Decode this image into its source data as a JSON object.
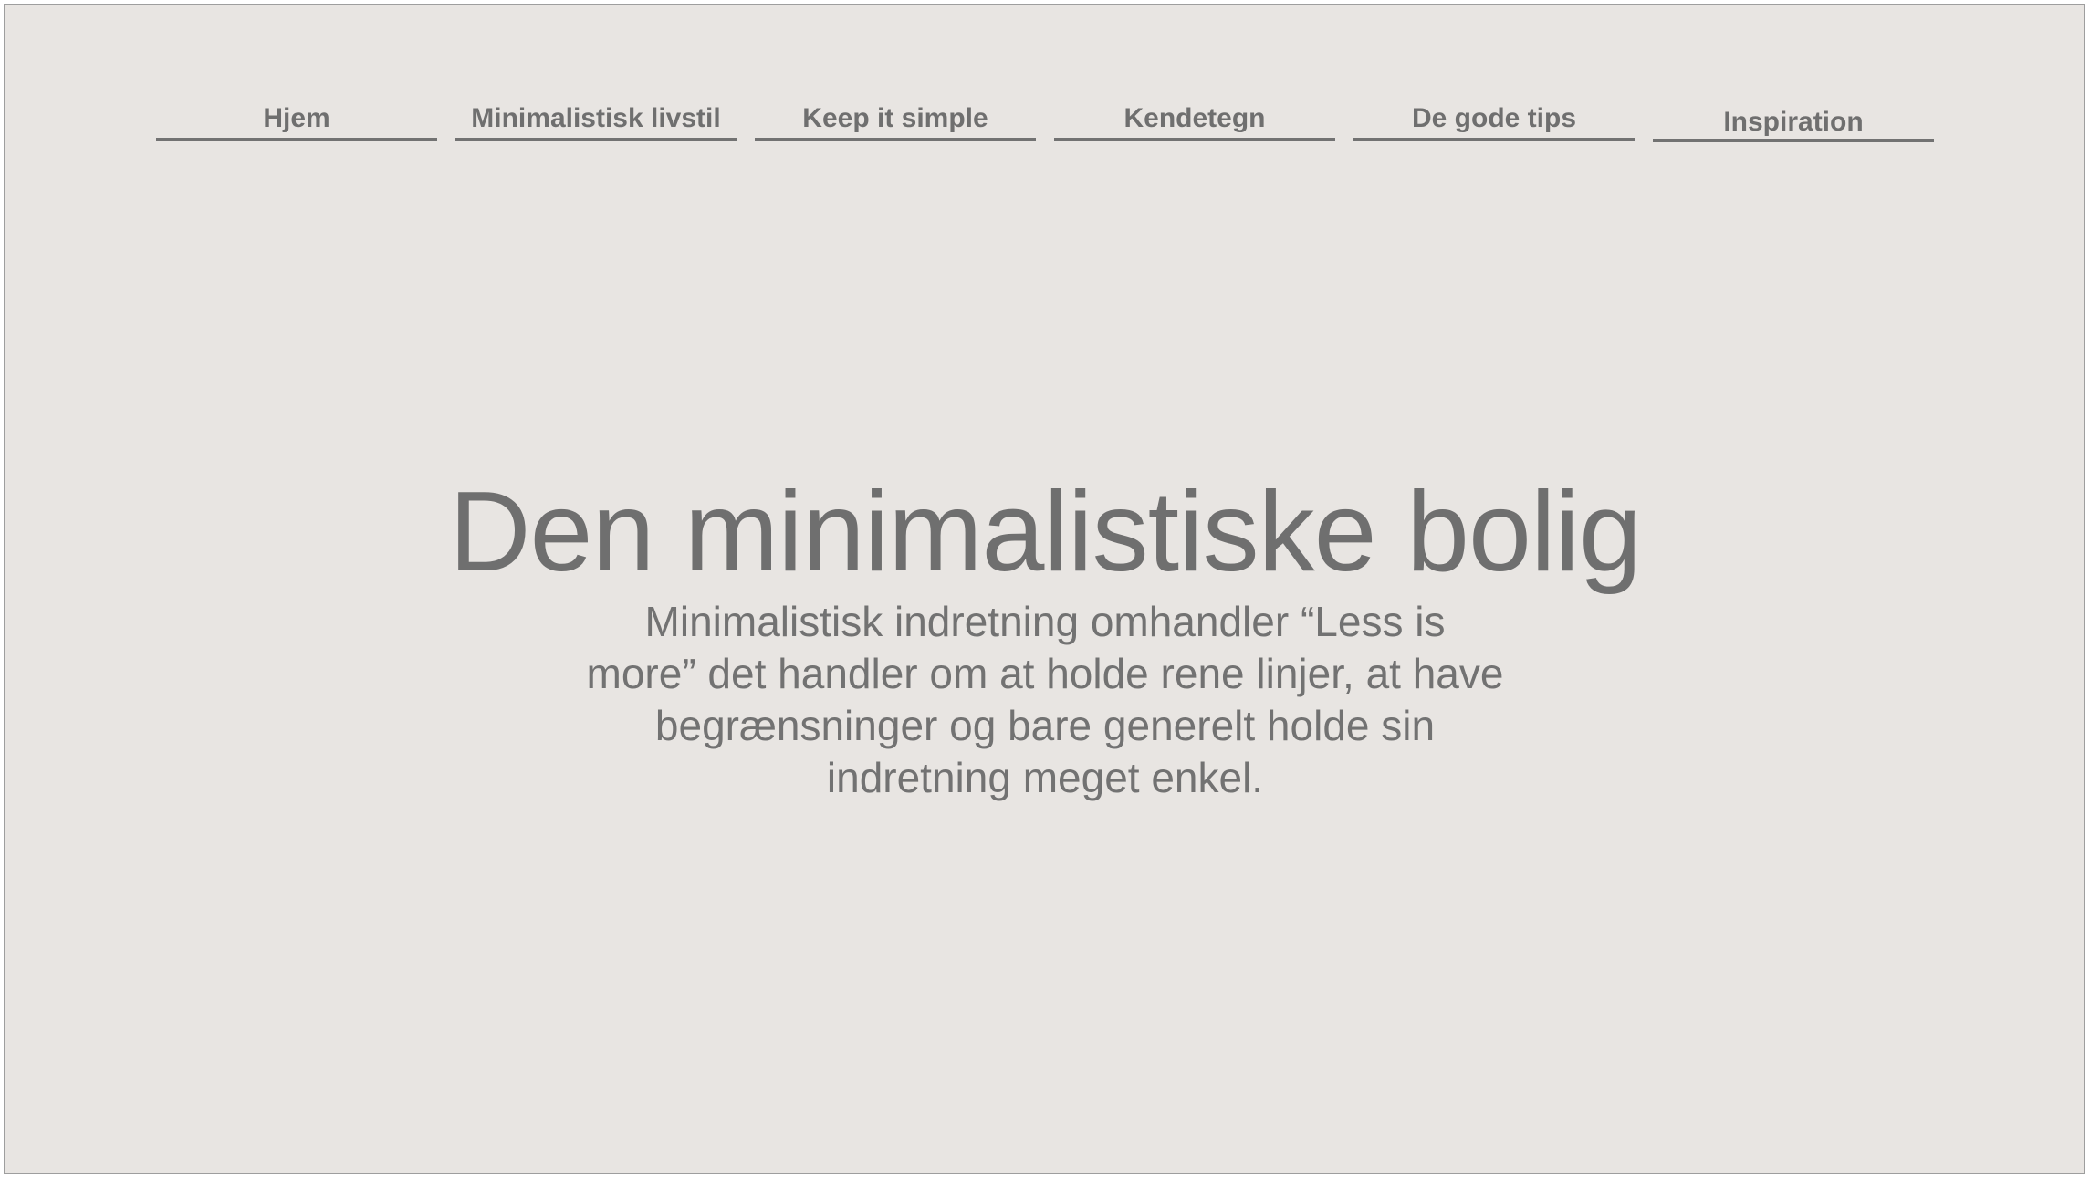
{
  "nav": {
    "items": [
      {
        "label": "Hjem"
      },
      {
        "label": "Minimalistisk livstil"
      },
      {
        "label": "Keep it simple"
      },
      {
        "label": "Kendetegn"
      },
      {
        "label": "De gode tips"
      },
      {
        "label": "Inspiration"
      }
    ]
  },
  "hero": {
    "title": "Den minimalistiske bolig",
    "text_lines": [
      "Minimalistisk indretning omhandler “Less is",
      "more” det handler om at holde rene linjer, at have",
      "begrænsninger og bare generelt holde sin",
      "indretning meget enkel."
    ]
  },
  "colors": {
    "background": "#e8e5e2",
    "text": "#727272"
  }
}
